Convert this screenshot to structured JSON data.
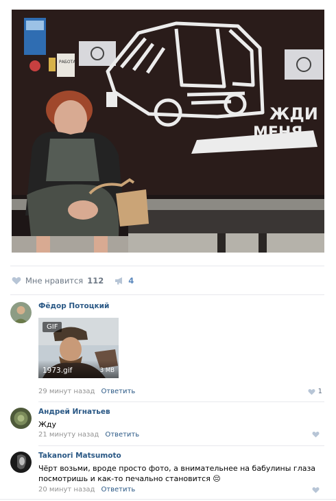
{
  "post": {
    "photo": {
      "graffiti_line1": "ЖДИ",
      "graffiti_line2": "МЕНЯ",
      "sign_label": "РАБОТА"
    },
    "likes": {
      "label": "Мне нравится",
      "count": "112"
    },
    "shares": {
      "count": "4"
    }
  },
  "comments": [
    {
      "author": "Фёдор Потоцкий",
      "gif": {
        "badge": "GIF",
        "filename": "1973.gif",
        "size": "3 MB"
      },
      "time": "29 минут назад",
      "reply_label": "Ответить",
      "likes": "1"
    },
    {
      "author": "Андрей Игнатьев",
      "text": "Жду",
      "time": "21 минуту назад",
      "reply_label": "Ответить"
    },
    {
      "author": "Takanori Matsumoto",
      "text": "Чёрт возьми, вроде просто фото, а внимательнее на бабулины глаза посмотришь и как-то печально становится 😔",
      "time": "20 минут назад",
      "reply_label": "Ответить"
    }
  ],
  "colors": {
    "link": "#2a5885",
    "muted": "#939393",
    "accent": "#5b88bd",
    "divider": "#e7e8ec"
  }
}
